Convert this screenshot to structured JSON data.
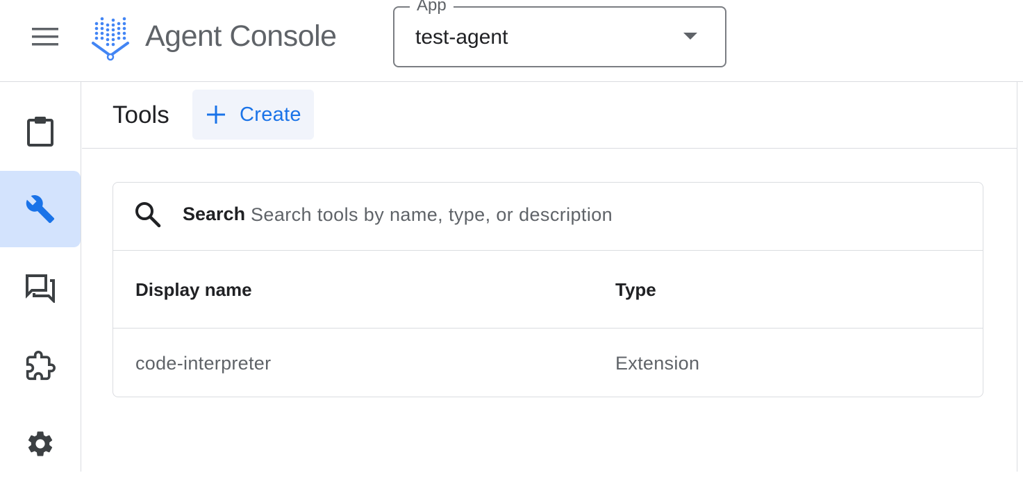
{
  "header": {
    "app_title": "Agent Console",
    "app_select": {
      "legend": "App",
      "value": "test-agent"
    }
  },
  "rail": {
    "items": [
      {
        "icon": "clipboard-icon",
        "active": false
      },
      {
        "icon": "wrench-icon",
        "active": true
      },
      {
        "icon": "forum-icon",
        "active": false
      },
      {
        "icon": "extension-icon",
        "active": false
      },
      {
        "icon": "gear-icon",
        "active": false
      }
    ]
  },
  "page": {
    "title": "Tools",
    "create_label": "Create"
  },
  "search": {
    "label": "Search",
    "placeholder": "Search tools by name, type, or description",
    "value": ""
  },
  "table": {
    "columns": [
      "Display name",
      "Type"
    ],
    "rows": [
      [
        "code-interpreter",
        "Extension"
      ]
    ]
  },
  "colors": {
    "accent": "#1a73e8",
    "active_rail_bg": "#d3e3fd",
    "create_bg": "#f1f4fb",
    "logo_blue": "#4285f4"
  }
}
